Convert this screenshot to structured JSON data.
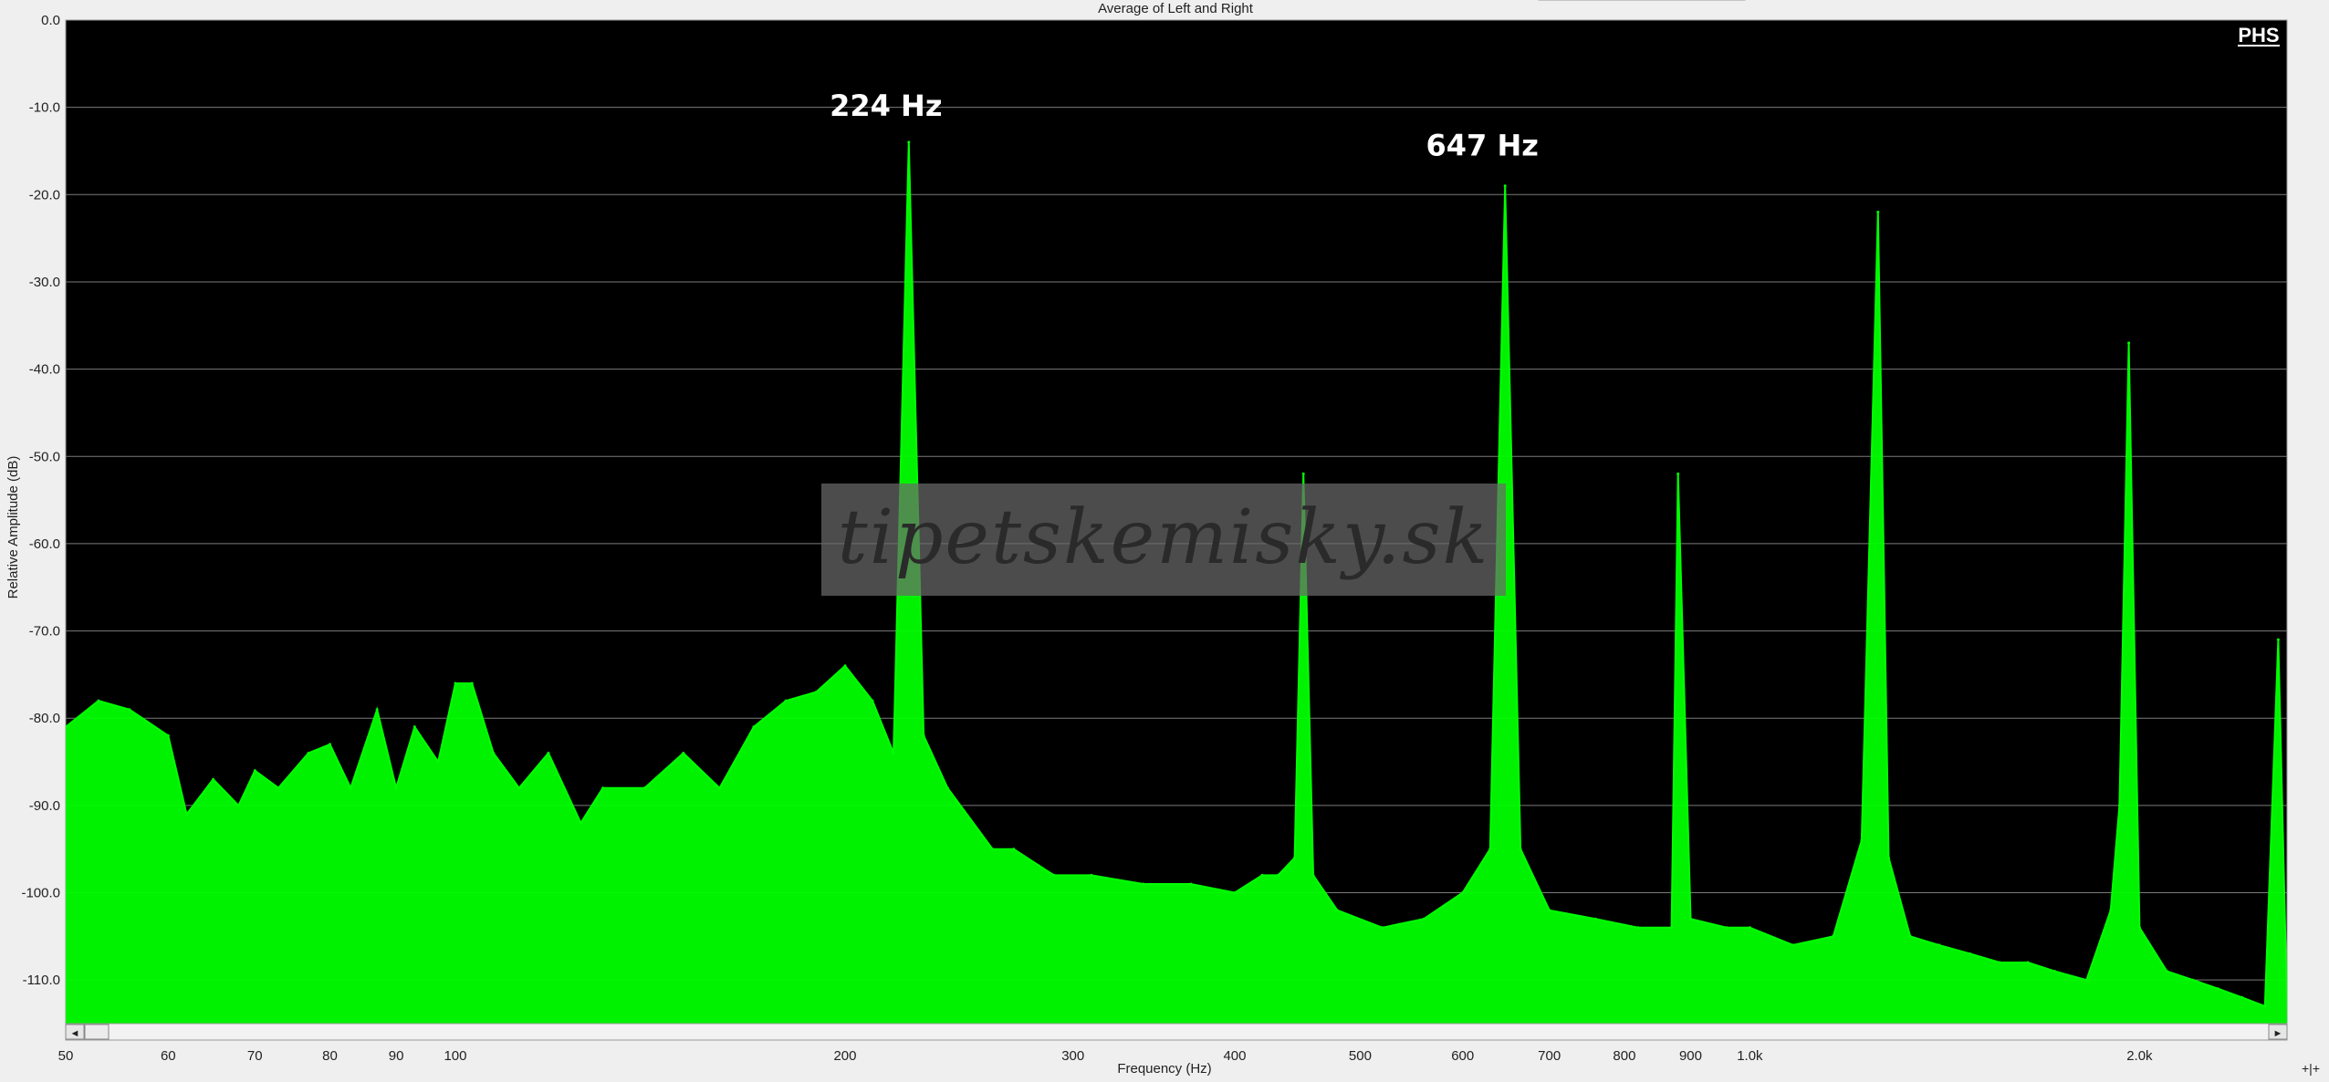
{
  "chart_data": {
    "type": "area",
    "title": "Average of Left and Right",
    "xlabel": "Frequency (Hz)",
    "ylabel": "Relative Amplitude (dB)",
    "x_scale": "log",
    "xlim": [
      50,
      2600
    ],
    "ylim": [
      -115,
      0
    ],
    "grid": true,
    "y_ticks": [
      {
        "v": 0,
        "label": "0.0"
      },
      {
        "v": -10,
        "label": "-10.0"
      },
      {
        "v": -20,
        "label": "-20.0"
      },
      {
        "v": -30,
        "label": "-30.0"
      },
      {
        "v": -40,
        "label": "-40.0"
      },
      {
        "v": -50,
        "label": "-50.0"
      },
      {
        "v": -60,
        "label": "-60.0"
      },
      {
        "v": -70,
        "label": "-70.0"
      },
      {
        "v": -80,
        "label": "-80.0"
      },
      {
        "v": -90,
        "label": "-90.0"
      },
      {
        "v": -100,
        "label": "-100.0"
      },
      {
        "v": -110,
        "label": "-110.0"
      }
    ],
    "x_ticks": [
      {
        "v": 50,
        "label": "50"
      },
      {
        "v": 60,
        "label": "60"
      },
      {
        "v": 70,
        "label": "70"
      },
      {
        "v": 80,
        "label": "80"
      },
      {
        "v": 90,
        "label": "90"
      },
      {
        "v": 100,
        "label": "100"
      },
      {
        "v": 200,
        "label": "200"
      },
      {
        "v": 300,
        "label": "300"
      },
      {
        "v": 400,
        "label": "400"
      },
      {
        "v": 500,
        "label": "500"
      },
      {
        "v": 600,
        "label": "600"
      },
      {
        "v": 700,
        "label": "700"
      },
      {
        "v": 800,
        "label": "800"
      },
      {
        "v": 900,
        "label": "900"
      },
      {
        "v": 1000,
        "label": "1.0k"
      },
      {
        "v": 2000,
        "label": "2.0k"
      }
    ],
    "series": [
      {
        "color": "#00ff00",
        "x": [
          50,
          53,
          56,
          60,
          62,
          65,
          68,
          70,
          73,
          77,
          80,
          83,
          87,
          90,
          93,
          97,
          100,
          103,
          107,
          112,
          118,
          125,
          130,
          140,
          150,
          160,
          170,
          180,
          190,
          200,
          210,
          218,
          224,
          230,
          240,
          260,
          270,
          290,
          310,
          340,
          370,
          400,
          420,
          432,
          445,
          452,
          460,
          480,
          520,
          560,
          600,
          630,
          647,
          665,
          700,
          760,
          820,
          870,
          880,
          900,
          960,
          1000,
          1080,
          1160,
          1220,
          1256,
          1280,
          1330,
          1400,
          1480,
          1560,
          1640,
          1720,
          1820,
          1900,
          1930,
          1962,
          2000,
          2100,
          2200,
          2300,
          2400,
          2500,
          2560,
          2600
        ],
        "y": [
          -81,
          -78,
          -79,
          -82,
          -91,
          -87,
          -90,
          -86,
          -88,
          -84,
          -83,
          -88,
          -79,
          -88,
          -81,
          -85,
          -76,
          -76,
          -84,
          -88,
          -84,
          -92,
          -88,
          -88,
          -84,
          -88,
          -81,
          -78,
          -77,
          -74,
          -78,
          -84,
          -14,
          -82,
          -88,
          -95,
          -95,
          -98,
          -98,
          -99,
          -99,
          -100,
          -98,
          -98,
          -96,
          -52,
          -98,
          -102,
          -104,
          -103,
          -100,
          -95,
          -19,
          -95,
          -102,
          -103,
          -104,
          -104,
          -52,
          -103,
          -104,
          -104,
          -106,
          -105,
          -94,
          -22,
          -96,
          -105,
          -106,
          -107,
          -108,
          -108,
          -109,
          -110,
          -102,
          -90,
          -37,
          -104,
          -109,
          -110,
          -111,
          -112,
          -113,
          -71,
          -113
        ]
      }
    ],
    "annotations": [
      {
        "text": "224 Hz",
        "x": 224,
        "y": -11
      },
      {
        "text": "647 Hz",
        "x": 647,
        "y": -15.5
      }
    ]
  },
  "watermark": "tipetskemisky.sk",
  "logo": "PHS",
  "scroll": {
    "left_arrow": "◄",
    "right_arrow": "►"
  },
  "corner_mark": "+|+"
}
